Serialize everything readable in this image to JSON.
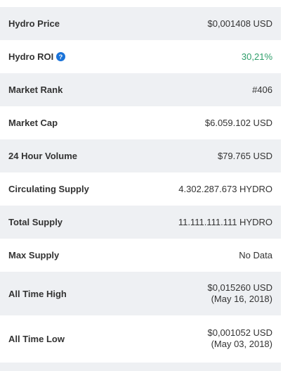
{
  "rows": [
    {
      "label": "Hydro Price",
      "value": "$0,001408 USD"
    },
    {
      "label": "Hydro ROI",
      "value": "30,21%"
    },
    {
      "label": "Market Rank",
      "value": "#406"
    },
    {
      "label": "Market Cap",
      "value": "$6.059.102 USD"
    },
    {
      "label": "24 Hour Volume",
      "value": "$79.765 USD"
    },
    {
      "label": "Circulating Supply",
      "value": "4.302.287.673 HYDRO"
    },
    {
      "label": "Total Supply",
      "value": "11.111.111.111 HYDRO"
    },
    {
      "label": "Max Supply",
      "value": "No Data"
    },
    {
      "label": "All Time High",
      "value_line1": "$0,015260 USD",
      "value_line2": "(May 16, 2018)"
    },
    {
      "label": "All Time Low",
      "value_line1": "$0,001052 USD",
      "value_line2": "(May 03, 2018)"
    }
  ],
  "icons": {
    "roi_info": "info-icon"
  },
  "colors": {
    "stripe": "#eef0f3",
    "roi_green": "#2e9e6a",
    "info_blue": "#1a73d9"
  }
}
